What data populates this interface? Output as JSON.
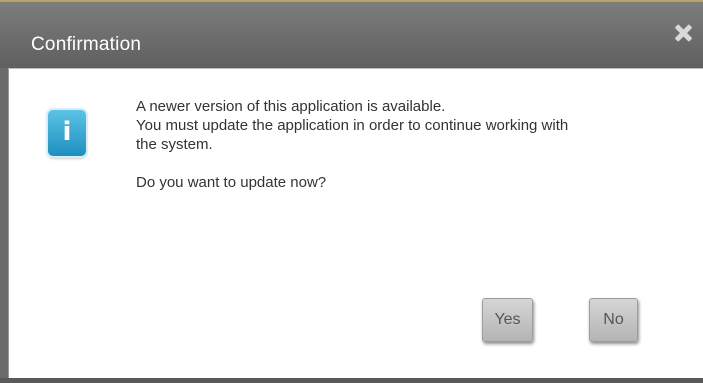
{
  "dialog": {
    "title": "Confirmation",
    "close_icon": "close-icon",
    "info_icon": "info-icon",
    "info_glyph": "i",
    "message": {
      "line1": "A newer version of this application is available.",
      "line2": "You must update the application in order to continue working with",
      "line3": "the system.",
      "question": "Do you want to update now?"
    },
    "buttons": {
      "yes_label": "Yes",
      "no_label": "No"
    }
  }
}
